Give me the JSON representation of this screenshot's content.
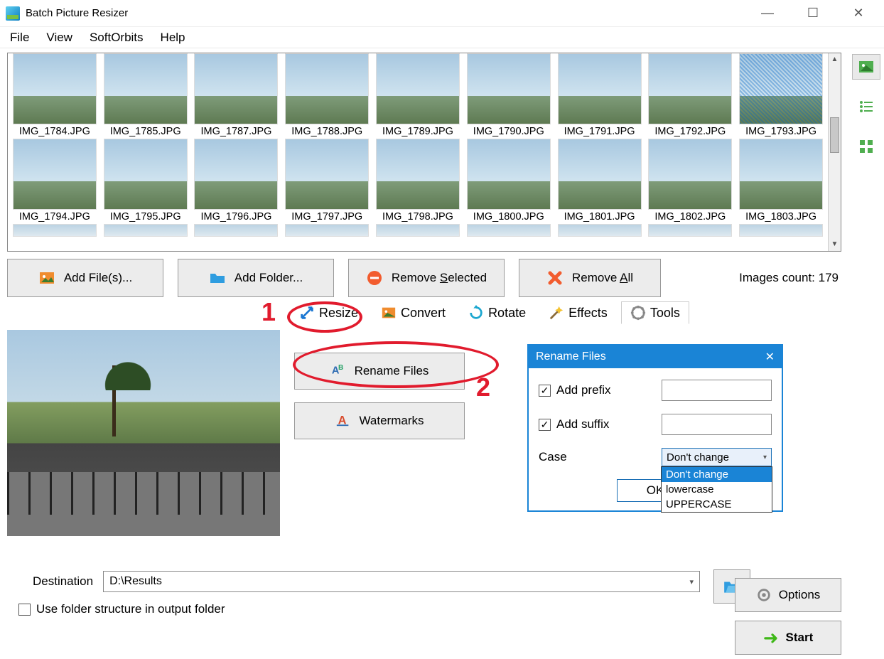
{
  "window": {
    "title": "Batch Picture Resizer"
  },
  "menu": {
    "file": "File",
    "view": "View",
    "softorbits": "SoftOrbits",
    "help": "Help"
  },
  "thumbs_row1": [
    "IMG_1784.JPG",
    "IMG_1785.JPG",
    "IMG_1787.JPG",
    "IMG_1788.JPG",
    "IMG_1789.JPG",
    "IMG_1790.JPG",
    "IMG_1791.JPG",
    "IMG_1792.JPG",
    "IMG_1793.JPG"
  ],
  "thumbs_row2": [
    "IMG_1794.JPG",
    "IMG_1795.JPG",
    "IMG_1796.JPG",
    "IMG_1797.JPG",
    "IMG_1798.JPG",
    "IMG_1800.JPG",
    "IMG_1801.JPG",
    "IMG_1802.JPG",
    "IMG_1803.JPG"
  ],
  "actions": {
    "add_files": "Add File(s)...",
    "add_folder": "Add Folder...",
    "remove_selected_pre": "Remove ",
    "remove_selected_u": "S",
    "remove_selected_post": "elected",
    "remove_all_pre": "Remove ",
    "remove_all_u": "A",
    "remove_all_post": "ll"
  },
  "images_count": "Images count: 179",
  "tabs": {
    "resize": "Resize",
    "convert": "Convert",
    "rotate": "Rotate",
    "effects": "Effects",
    "tools": "Tools"
  },
  "tool_buttons": {
    "rename": "Rename Files",
    "watermarks": "Watermarks"
  },
  "dialog": {
    "title": "Rename Files",
    "add_prefix": "Add prefix",
    "add_suffix": "Add suffix",
    "case": "Case",
    "case_value": "Don't change",
    "opts": {
      "dont_change": "Don't change",
      "lowercase": "lowercase",
      "uppercase": "UPPERCASE"
    },
    "ok": "OK"
  },
  "annot": {
    "one": "1",
    "two": "2"
  },
  "dest": {
    "label": "Destination",
    "value": "D:\\Results"
  },
  "folder_chk": "Use folder structure in output folder",
  "options_btn": "Options",
  "start_btn": "Start"
}
